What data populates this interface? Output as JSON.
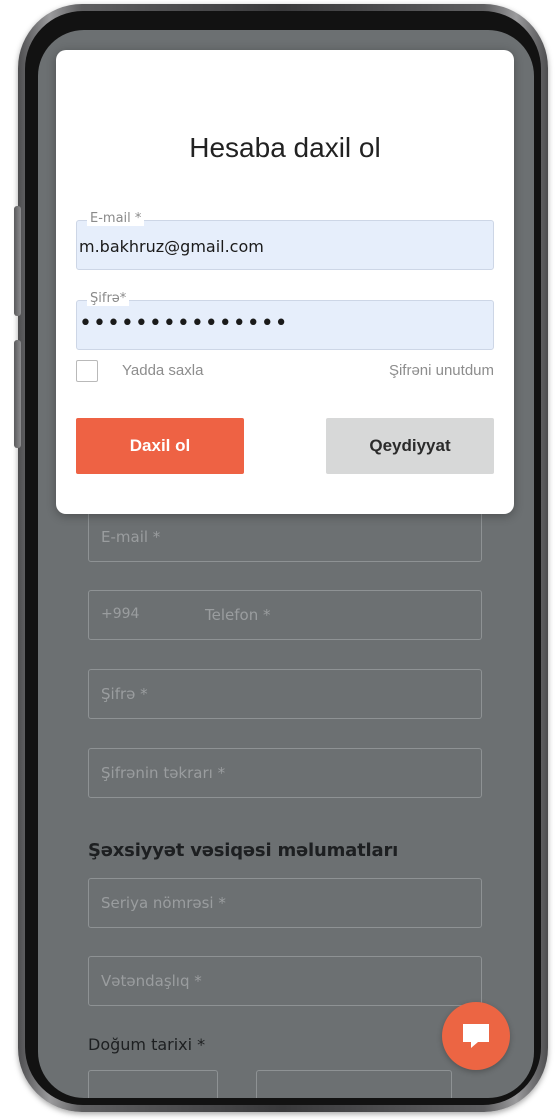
{
  "login_modal": {
    "title": "Hesaba daxil ol",
    "email_label": "E-mail *",
    "email_value": "m.bakhruz@gmail.com",
    "password_label": "Şifrə*",
    "password_value": "•••••••••••••••",
    "remember_label": "Yadda saxla",
    "forgot_label": "Şifrəni unutdum",
    "login_button": "Daxil ol",
    "register_button": "Qeydiyyat"
  },
  "registration_form": {
    "email_placeholder": "E-mail *",
    "phone_prefix": "+994",
    "phone_placeholder": "Telefon *",
    "password_placeholder": "Şifrə *",
    "password_repeat_placeholder": "Şifrənin təkrarı *",
    "id_section_heading": "Şəxsiyyət vəsiqəsi məlumatları",
    "serial_placeholder": "Seriya nömrəsi *",
    "citizenship_placeholder": "Vətəndaşlıq *",
    "birthdate_label": "Doğum tarixi *"
  },
  "chat_button": {
    "icon": "chat-icon"
  },
  "colors": {
    "accent": "#ee6244",
    "overlay": "#6c7072",
    "input_bg": "#e6eefb",
    "secondary_button": "#d7d8d8"
  }
}
